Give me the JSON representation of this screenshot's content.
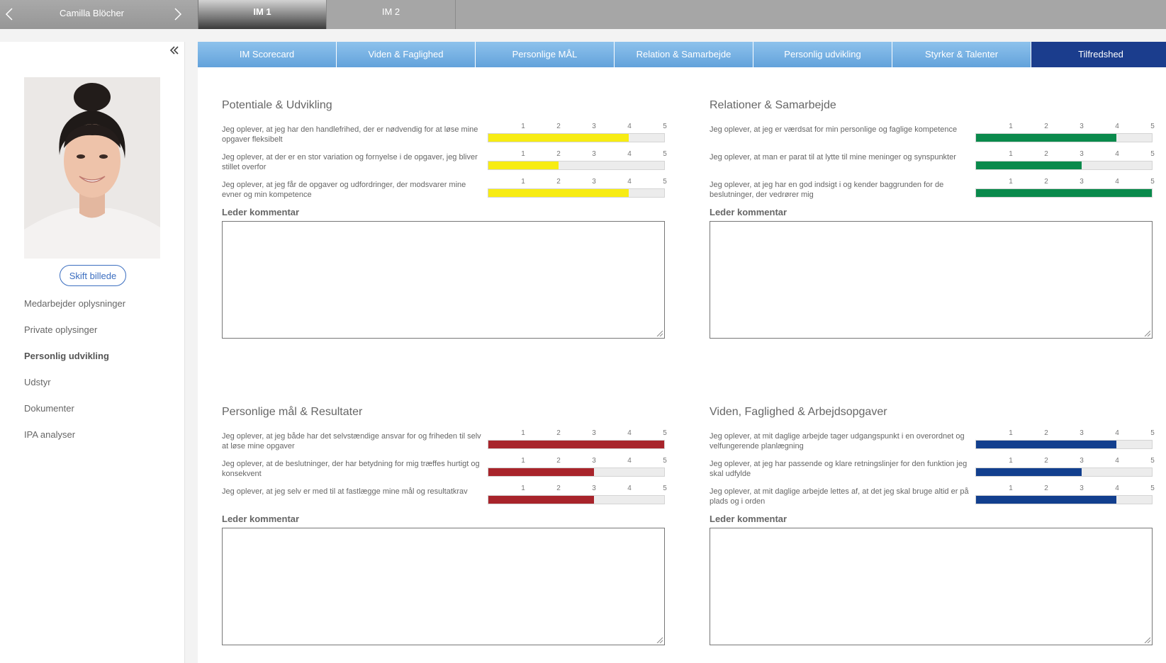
{
  "header": {
    "person_name": "Camilla Blöcher",
    "im_tabs": [
      {
        "label": "IM 1",
        "active": true
      },
      {
        "label": "IM 2",
        "active": false
      }
    ]
  },
  "sidebar": {
    "change_photo_label": "Skift billede",
    "menu": [
      {
        "label": "Medarbejder oplysninger",
        "active": false
      },
      {
        "label": "Private oplysinger",
        "active": false
      },
      {
        "label": "Personlig udvikling",
        "active": true
      },
      {
        "label": "Udstyr",
        "active": false
      },
      {
        "label": "Dokumenter",
        "active": false
      },
      {
        "label": "IPA analyser",
        "active": false
      }
    ]
  },
  "tabs": [
    {
      "label": "IM Scorecard",
      "active": false
    },
    {
      "label": "Viden & Faglighed",
      "active": false
    },
    {
      "label": "Personlige MÅL",
      "active": false
    },
    {
      "label": "Relation & Samarbejde",
      "active": false
    },
    {
      "label": "Personlig udvikling",
      "active": false
    },
    {
      "label": "Styrker & Talenter",
      "active": false
    },
    {
      "label": "Tilfredshed",
      "active": true
    }
  ],
  "scale_labels": [
    "1",
    "2",
    "3",
    "4",
    "5"
  ],
  "colors": {
    "yellow": "#f7ec13",
    "green": "#0a8a4c",
    "red": "#a8242b",
    "blue": "#123f8e"
  },
  "sections": [
    {
      "title": "Potentiale & Udvikling",
      "color": "#f7ec13",
      "comment_label": "Leder kommentar",
      "comment_value": "",
      "questions": [
        {
          "text": "Jeg oplever, at jeg har den handlefrihed, der er nødvendig for at løse mine opgaver fleksibelt",
          "score": 4
        },
        {
          "text": "Jeg oplever, at der er en stor variation og fornyelse i de opgaver, jeg bliver stillet overfor",
          "score": 2
        },
        {
          "text": "Jeg oplever, at jeg får de opgaver og udfordringer, der modsvarer mine evner og min kompetence",
          "score": 4
        }
      ]
    },
    {
      "title": "Relationer & Samarbejde",
      "color": "#0a8a4c",
      "comment_label": "Leder kommentar",
      "comment_value": "",
      "questions": [
        {
          "text": "Jeg oplever, at jeg er værdsat for min personlige og faglige kompetence",
          "score": 4
        },
        {
          "text": "Jeg oplever, at man er parat til at lytte til mine meninger og synspunkter",
          "score": 3
        },
        {
          "text": "Jeg oplever, at jeg har en god indsigt i og kender baggrunden for de beslutninger, der vedrører mig",
          "score": 5
        }
      ]
    },
    {
      "title": "Personlige mål & Resultater",
      "color": "#a8242b",
      "comment_label": "Leder kommentar",
      "comment_value": "",
      "questions": [
        {
          "text": "Jeg oplever, at jeg både har det selvstændige ansvar for og friheden til selv at løse mine opgaver",
          "score": 5
        },
        {
          "text": "Jeg oplever, at de beslutninger, der har betydning for mig træffes hurtigt og konsekvent",
          "score": 3
        },
        {
          "text": "Jeg oplever, at jeg selv er med til at fastlægge mine mål og resultatkrav",
          "score": 3
        }
      ]
    },
    {
      "title": "Viden, Faglighed & Arbejdsopgaver",
      "color": "#123f8e",
      "comment_label": "Leder kommentar",
      "comment_value": "",
      "questions": [
        {
          "text": "Jeg oplever, at mit daglige arbejde tager udgangspunkt i en overordnet og velfungerende planlægning",
          "score": 4
        },
        {
          "text": "Jeg oplever, at jeg har passende og klare retningslinjer for den funktion jeg skal udfylde",
          "score": 3
        },
        {
          "text": "Jeg oplever, at mit daglige arbejde lettes af, at det jeg skal bruge altid er på plads og i orden",
          "score": 4
        }
      ]
    }
  ]
}
